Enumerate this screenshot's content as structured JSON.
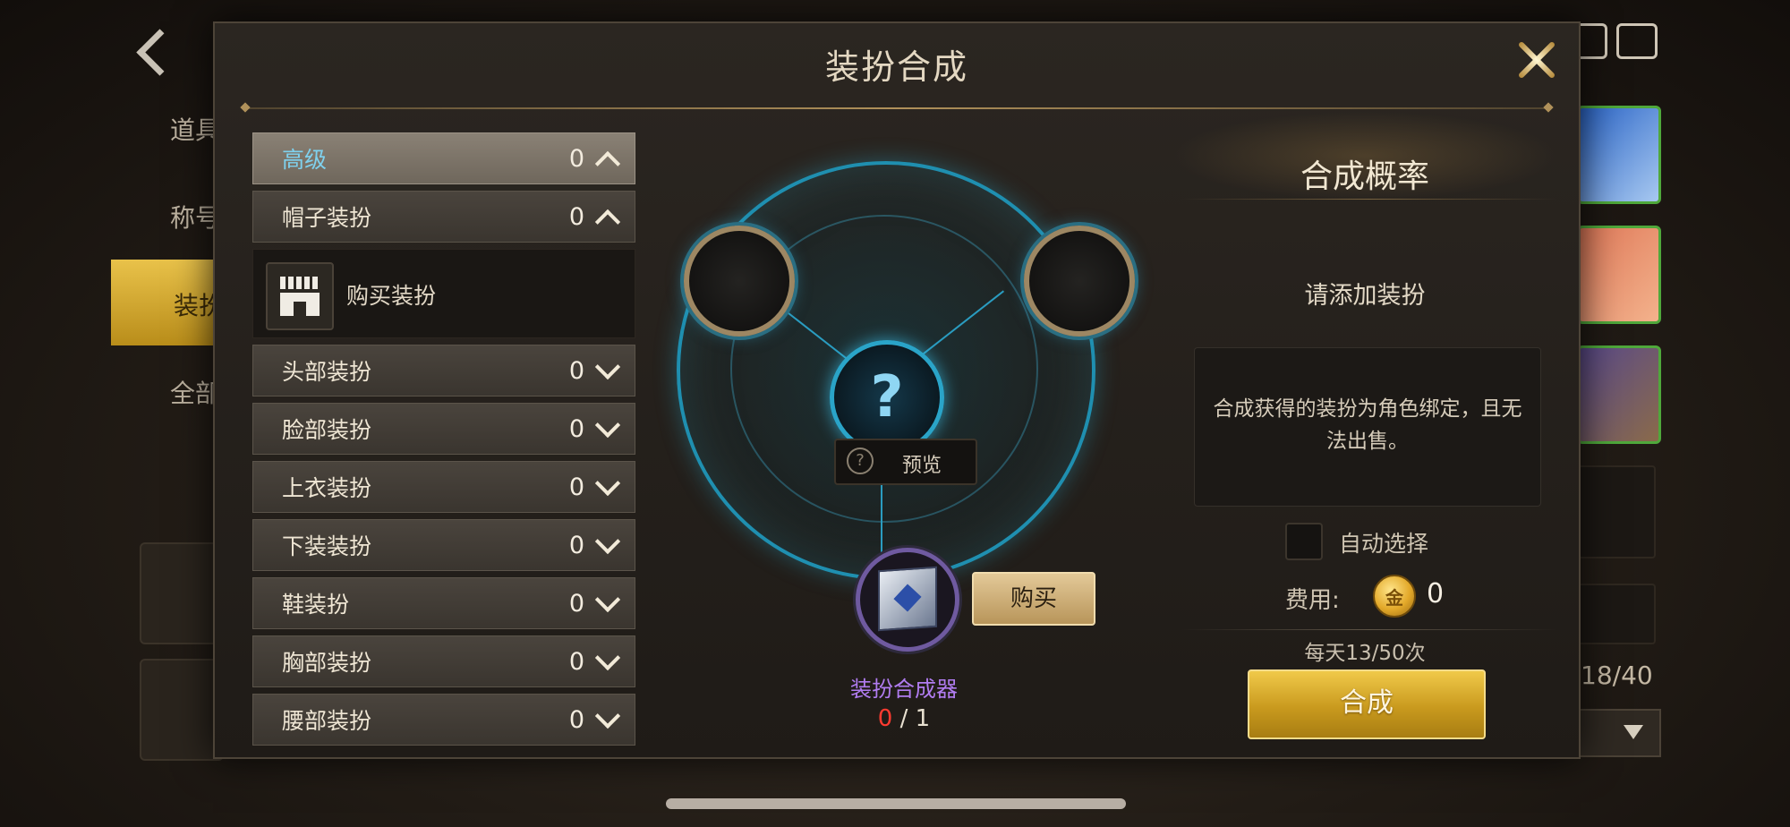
{
  "background": {
    "side_items": [
      "道具",
      "称号",
      "装扮",
      "全部"
    ],
    "item_count": "18/40",
    "colors": {
      "active_tab": "#d8b03a",
      "thumb_border": "#4fa83b"
    }
  },
  "modal": {
    "title": "装扮合成",
    "categories": [
      {
        "label": "高级",
        "count": "0",
        "expanded": true,
        "selected": true
      },
      {
        "label": "帽子装扮",
        "count": "0",
        "expanded": true,
        "selected": false
      },
      {
        "label": "头部装扮",
        "count": "0",
        "expanded": false
      },
      {
        "label": "脸部装扮",
        "count": "0",
        "expanded": false
      },
      {
        "label": "上衣装扮",
        "count": "0",
        "expanded": false
      },
      {
        "label": "下装装扮",
        "count": "0",
        "expanded": false
      },
      {
        "label": "鞋装扮",
        "count": "0",
        "expanded": false
      },
      {
        "label": "胸部装扮",
        "count": "0",
        "expanded": false
      },
      {
        "label": "腰部装扮",
        "count": "0",
        "expanded": false
      }
    ],
    "buy_costume_label": "购买装扮",
    "synthesis": {
      "center_icon": "?",
      "preview_label": "预览",
      "buy_label": "购买",
      "material_name": "装扮合成器",
      "material_current": "0",
      "material_sep_total": " / 1"
    },
    "right_panel": {
      "title": "合成概率",
      "hint": "请添加装扮",
      "note": "合成获得的装扮为角色绑定，且无法出售。",
      "auto_select_label": "自动选择",
      "auto_select_checked": false,
      "fee_label": "费用:",
      "coin_glyph": "金",
      "fee_value": "0",
      "daily_limit": "每天13/50次",
      "synthesize_label": "合成"
    },
    "colors": {
      "accent_cyan": "#2aa4c8",
      "material_purple": "#b07cf0",
      "count_red": "#ff3b30",
      "button_gold": "#d4a62a"
    }
  }
}
